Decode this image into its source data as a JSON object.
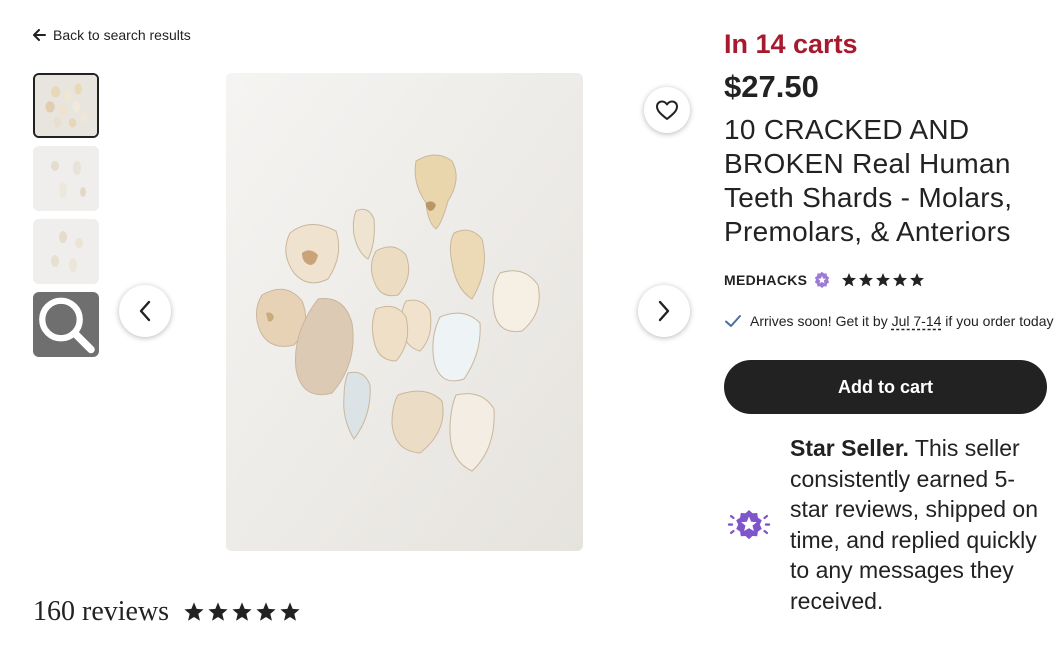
{
  "nav": {
    "back_label": "Back to search results"
  },
  "gallery": {
    "thumbnail_count": 3,
    "active_index": 0
  },
  "listing": {
    "carts_text": "In 14 carts",
    "price": "$27.50",
    "title": "10 CRACKED AND BROKEN Real Human Teeth Shards - Molars, Premolars, & Anteriors"
  },
  "shop": {
    "name": "MEDHACKS",
    "rating_stars": 5
  },
  "delivery": {
    "prefix": "Arrives soon! Get it by ",
    "date": "Jul 7-14",
    "suffix": " if you order today"
  },
  "cart_button": {
    "label": "Add to cart"
  },
  "star_seller": {
    "heading": "Star Seller.",
    "body": " This seller consistently earned 5-star reviews, shipped on time, and replied quickly to any messages they received."
  },
  "reviews": {
    "count_label": "160 reviews",
    "rating_stars": 5
  },
  "colors": {
    "carts_red": "#a61a2e",
    "badge_purple": "#7f55cc",
    "button_dark": "#222222"
  },
  "icons": {
    "back": "arrow-left-icon",
    "favorite": "heart-outline-icon",
    "prev": "chevron-left-icon",
    "next": "chevron-right-icon",
    "zoom": "magnifier-icon",
    "star_seller_badge": "star-seller-badge-icon",
    "delivery_check": "check-icon"
  }
}
